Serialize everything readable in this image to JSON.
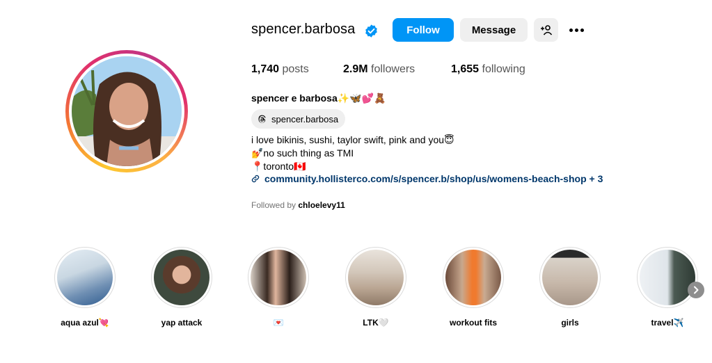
{
  "profile": {
    "username": "spencer.barbosa",
    "verified": true,
    "buttons": {
      "follow": "Follow",
      "message": "Message"
    },
    "stats": {
      "posts_value": "1,740",
      "posts_label": "posts",
      "followers_value": "2.9M",
      "followers_label": "followers",
      "following_value": "1,655",
      "following_label": "following"
    },
    "full_name": "spencer e barbosa✨🦋💕🧸",
    "threads_handle": "spencer.barbosa",
    "bio": [
      "i love bikinis, sushi, taylor swift, pink and you😇",
      "💅no such thing as TMI",
      "📍toronto🇨🇦"
    ],
    "link": "community.hollisterco.com/s/spencer.b/shop/us/womens-beach-shop + 3",
    "followed_by_prefix": "Followed by",
    "followed_by_user": "chloelevy11"
  },
  "highlights": [
    {
      "label": "aqua azul💘"
    },
    {
      "label": "yap attack"
    },
    {
      "label": "💌"
    },
    {
      "label": "LTK🤍"
    },
    {
      "label": "workout fits"
    },
    {
      "label": "girls"
    },
    {
      "label": "travel✈️"
    }
  ],
  "colors": {
    "accent": "#0095f6",
    "link": "#00376b",
    "button_gray": "#efefef"
  }
}
